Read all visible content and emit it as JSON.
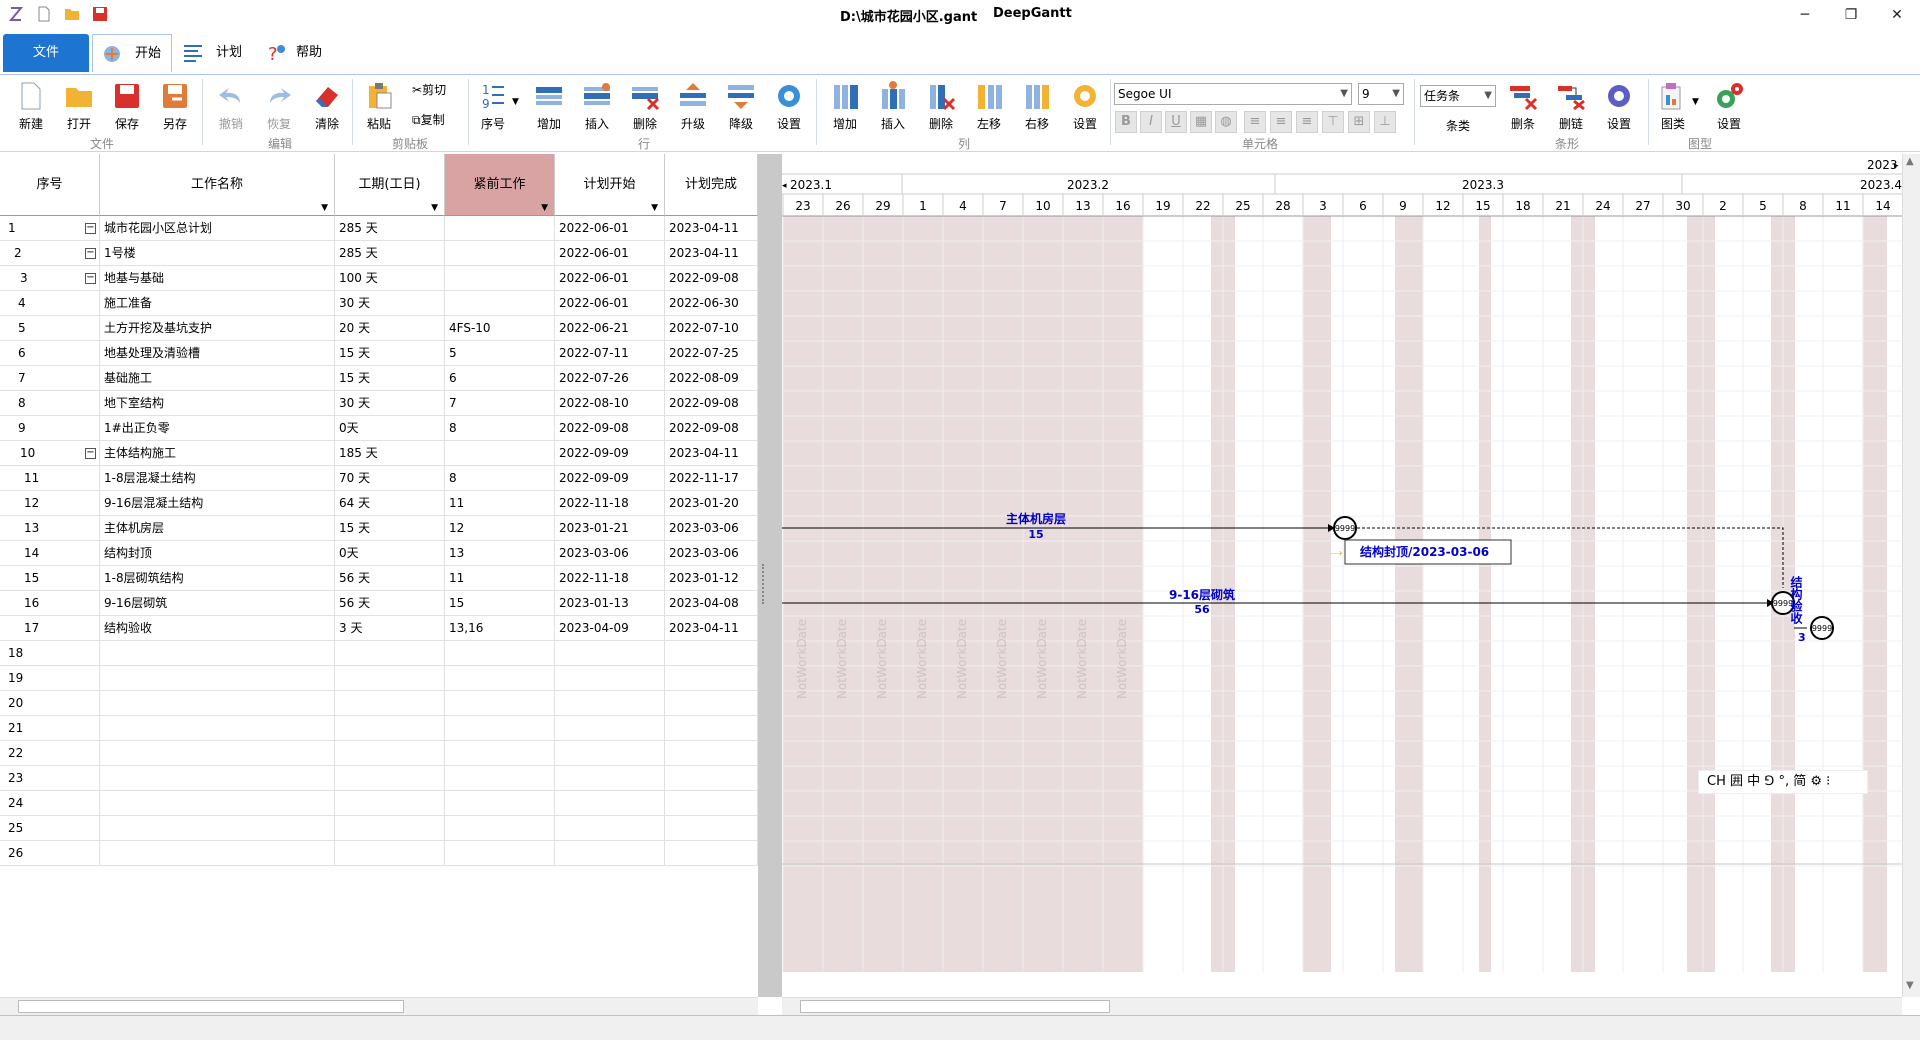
{
  "window": {
    "title": "D:\\城市花园小区.gant",
    "app_name": "DeepGantt"
  },
  "tabs": {
    "file": "文件",
    "home": "开始",
    "plan": "计划",
    "help": "帮助"
  },
  "ribbon": {
    "file_group": {
      "label": "文件",
      "new": "新建",
      "open": "打开",
      "save": "保存",
      "save_as": "另存"
    },
    "edit_group": {
      "label": "编辑",
      "undo": "撤销",
      "redo": "恢复",
      "clear": "清除"
    },
    "clipboard_group": {
      "label": "剪贴板",
      "paste": "粘贴",
      "cut": "剪切",
      "copy": "复制"
    },
    "row_group": {
      "label": "行",
      "seq": "序号",
      "add": "增加",
      "insert": "插入",
      "delete": "删除",
      "promote": "升级",
      "demote": "降级",
      "settings": "设置"
    },
    "col_group": {
      "label": "列",
      "add": "增加",
      "insert": "插入",
      "delete": "删除",
      "move_left": "左移",
      "move_right": "右移",
      "settings": "设置"
    },
    "cell_group": {
      "label": "单元格",
      "font": "Segoe UI",
      "size": "9"
    },
    "bar_group": {
      "label": "条形",
      "bar_type": "任务条",
      "bar_type_label": "条类",
      "delete_bar": "删条",
      "delete_link": "删链",
      "settings": "设置"
    },
    "shape_group": {
      "label": "图型",
      "chart_type": "图类",
      "settings": "设置"
    }
  },
  "grid": {
    "columns": [
      "序号",
      "工作名称",
      "工期(工日)",
      "紧前工作",
      "计划开始",
      "计划完成"
    ],
    "rows": [
      {
        "seq": "1",
        "name": "城市花园小区总计划",
        "duration": "285 天",
        "pred": "",
        "start": "2022-06-01",
        "finish": "2023-04-11",
        "expand": "⊟"
      },
      {
        "seq": "2",
        "name": "1号楼",
        "duration": "285 天",
        "pred": "",
        "start": "2022-06-01",
        "finish": "2023-04-11",
        "expand": "⊟"
      },
      {
        "seq": "3",
        "name": "地基与基础",
        "duration": "100 天",
        "pred": "",
        "start": "2022-06-01",
        "finish": "2022-09-08",
        "expand": "⊟"
      },
      {
        "seq": "4",
        "name": "施工准备",
        "duration": "30 天",
        "pred": "",
        "start": "2022-06-01",
        "finish": "2022-06-30",
        "expand": ""
      },
      {
        "seq": "5",
        "name": "土方开挖及基坑支护",
        "duration": "20 天",
        "pred": "4FS-10",
        "start": "2022-06-21",
        "finish": "2022-07-10",
        "expand": ""
      },
      {
        "seq": "6",
        "name": "地基处理及清验槽",
        "duration": "15 天",
        "pred": "5",
        "start": "2022-07-11",
        "finish": "2022-07-25",
        "expand": ""
      },
      {
        "seq": "7",
        "name": "基础施工",
        "duration": "15 天",
        "pred": "6",
        "start": "2022-07-26",
        "finish": "2022-08-09",
        "expand": ""
      },
      {
        "seq": "8",
        "name": "地下室结构",
        "duration": "30 天",
        "pred": "7",
        "start": "2022-08-10",
        "finish": "2022-09-08",
        "expand": ""
      },
      {
        "seq": "9",
        "name": "1#出正负零",
        "duration": "0天",
        "pred": "8",
        "start": "2022-09-08",
        "finish": "2022-09-08",
        "expand": ""
      },
      {
        "seq": "10",
        "name": "主体结构施工",
        "duration": "185 天",
        "pred": "",
        "start": "2022-09-09",
        "finish": "2023-04-11",
        "expand": "⊟"
      },
      {
        "seq": "11",
        "name": "1-8层混凝土结构",
        "duration": "70 天",
        "pred": "8",
        "start": "2022-09-09",
        "finish": "2022-11-17",
        "expand": ""
      },
      {
        "seq": "12",
        "name": "9-16层混凝土结构",
        "duration": "64 天",
        "pred": "11",
        "start": "2022-11-18",
        "finish": "2023-01-20",
        "expand": ""
      },
      {
        "seq": "13",
        "name": "主体机房层",
        "duration": "15 天",
        "pred": "12",
        "start": "2023-01-21",
        "finish": "2023-03-06",
        "expand": ""
      },
      {
        "seq": "14",
        "name": "结构封顶",
        "duration": "0天",
        "pred": "13",
        "start": "2023-03-06",
        "finish": "2023-03-06",
        "expand": ""
      },
      {
        "seq": "15",
        "name": "1-8层砌筑结构",
        "duration": "56 天",
        "pred": "11",
        "start": "2022-11-18",
        "finish": "2023-01-12",
        "expand": ""
      },
      {
        "seq": "16",
        "name": "9-16层砌筑",
        "duration": "56 天",
        "pred": "15",
        "start": "2023-01-13",
        "finish": "2023-04-08",
        "expand": ""
      },
      {
        "seq": "17",
        "name": "结构验收",
        "duration": "3 天",
        "pred": "13,16",
        "start": "2023-04-09",
        "finish": "2023-04-11",
        "expand": ""
      },
      {
        "seq": "18"
      },
      {
        "seq": "19"
      },
      {
        "seq": "20"
      },
      {
        "seq": "21"
      },
      {
        "seq": "22"
      },
      {
        "seq": "23"
      },
      {
        "seq": "24"
      },
      {
        "seq": "25"
      },
      {
        "seq": "26"
      }
    ]
  },
  "gantt": {
    "year_corner": "2023",
    "months": [
      "2023.1",
      "2023.2",
      "2023.3",
      "2023.4"
    ],
    "days": [
      "23",
      "26",
      "29",
      "1",
      "4",
      "7",
      "10",
      "13",
      "16",
      "19",
      "22",
      "25",
      "28",
      "3",
      "6",
      "9",
      "12",
      "15",
      "18",
      "21",
      "24",
      "27",
      "30",
      "2",
      "5",
      "8",
      "11",
      "14"
    ],
    "nonwork_text": "NotWorkDate",
    "node_label": "9999",
    "tasks": [
      {
        "name": "主体机房层",
        "duration": "15"
      },
      {
        "name": "9-16层砌筑",
        "duration": "56"
      },
      {
        "name": "结构验收",
        "duration": "3"
      }
    ],
    "milestone_label": "结构封顶/2023-03-06"
  },
  "ime": {
    "text": "CH 囲 中 ⅁ °, 简 ⚙ ⁝"
  },
  "colors": {
    "accent": "#1e74d1",
    "predecessor_header": "#d9a3a3",
    "nonwork": "#e8dcdc",
    "task_text": "#0000cc"
  }
}
